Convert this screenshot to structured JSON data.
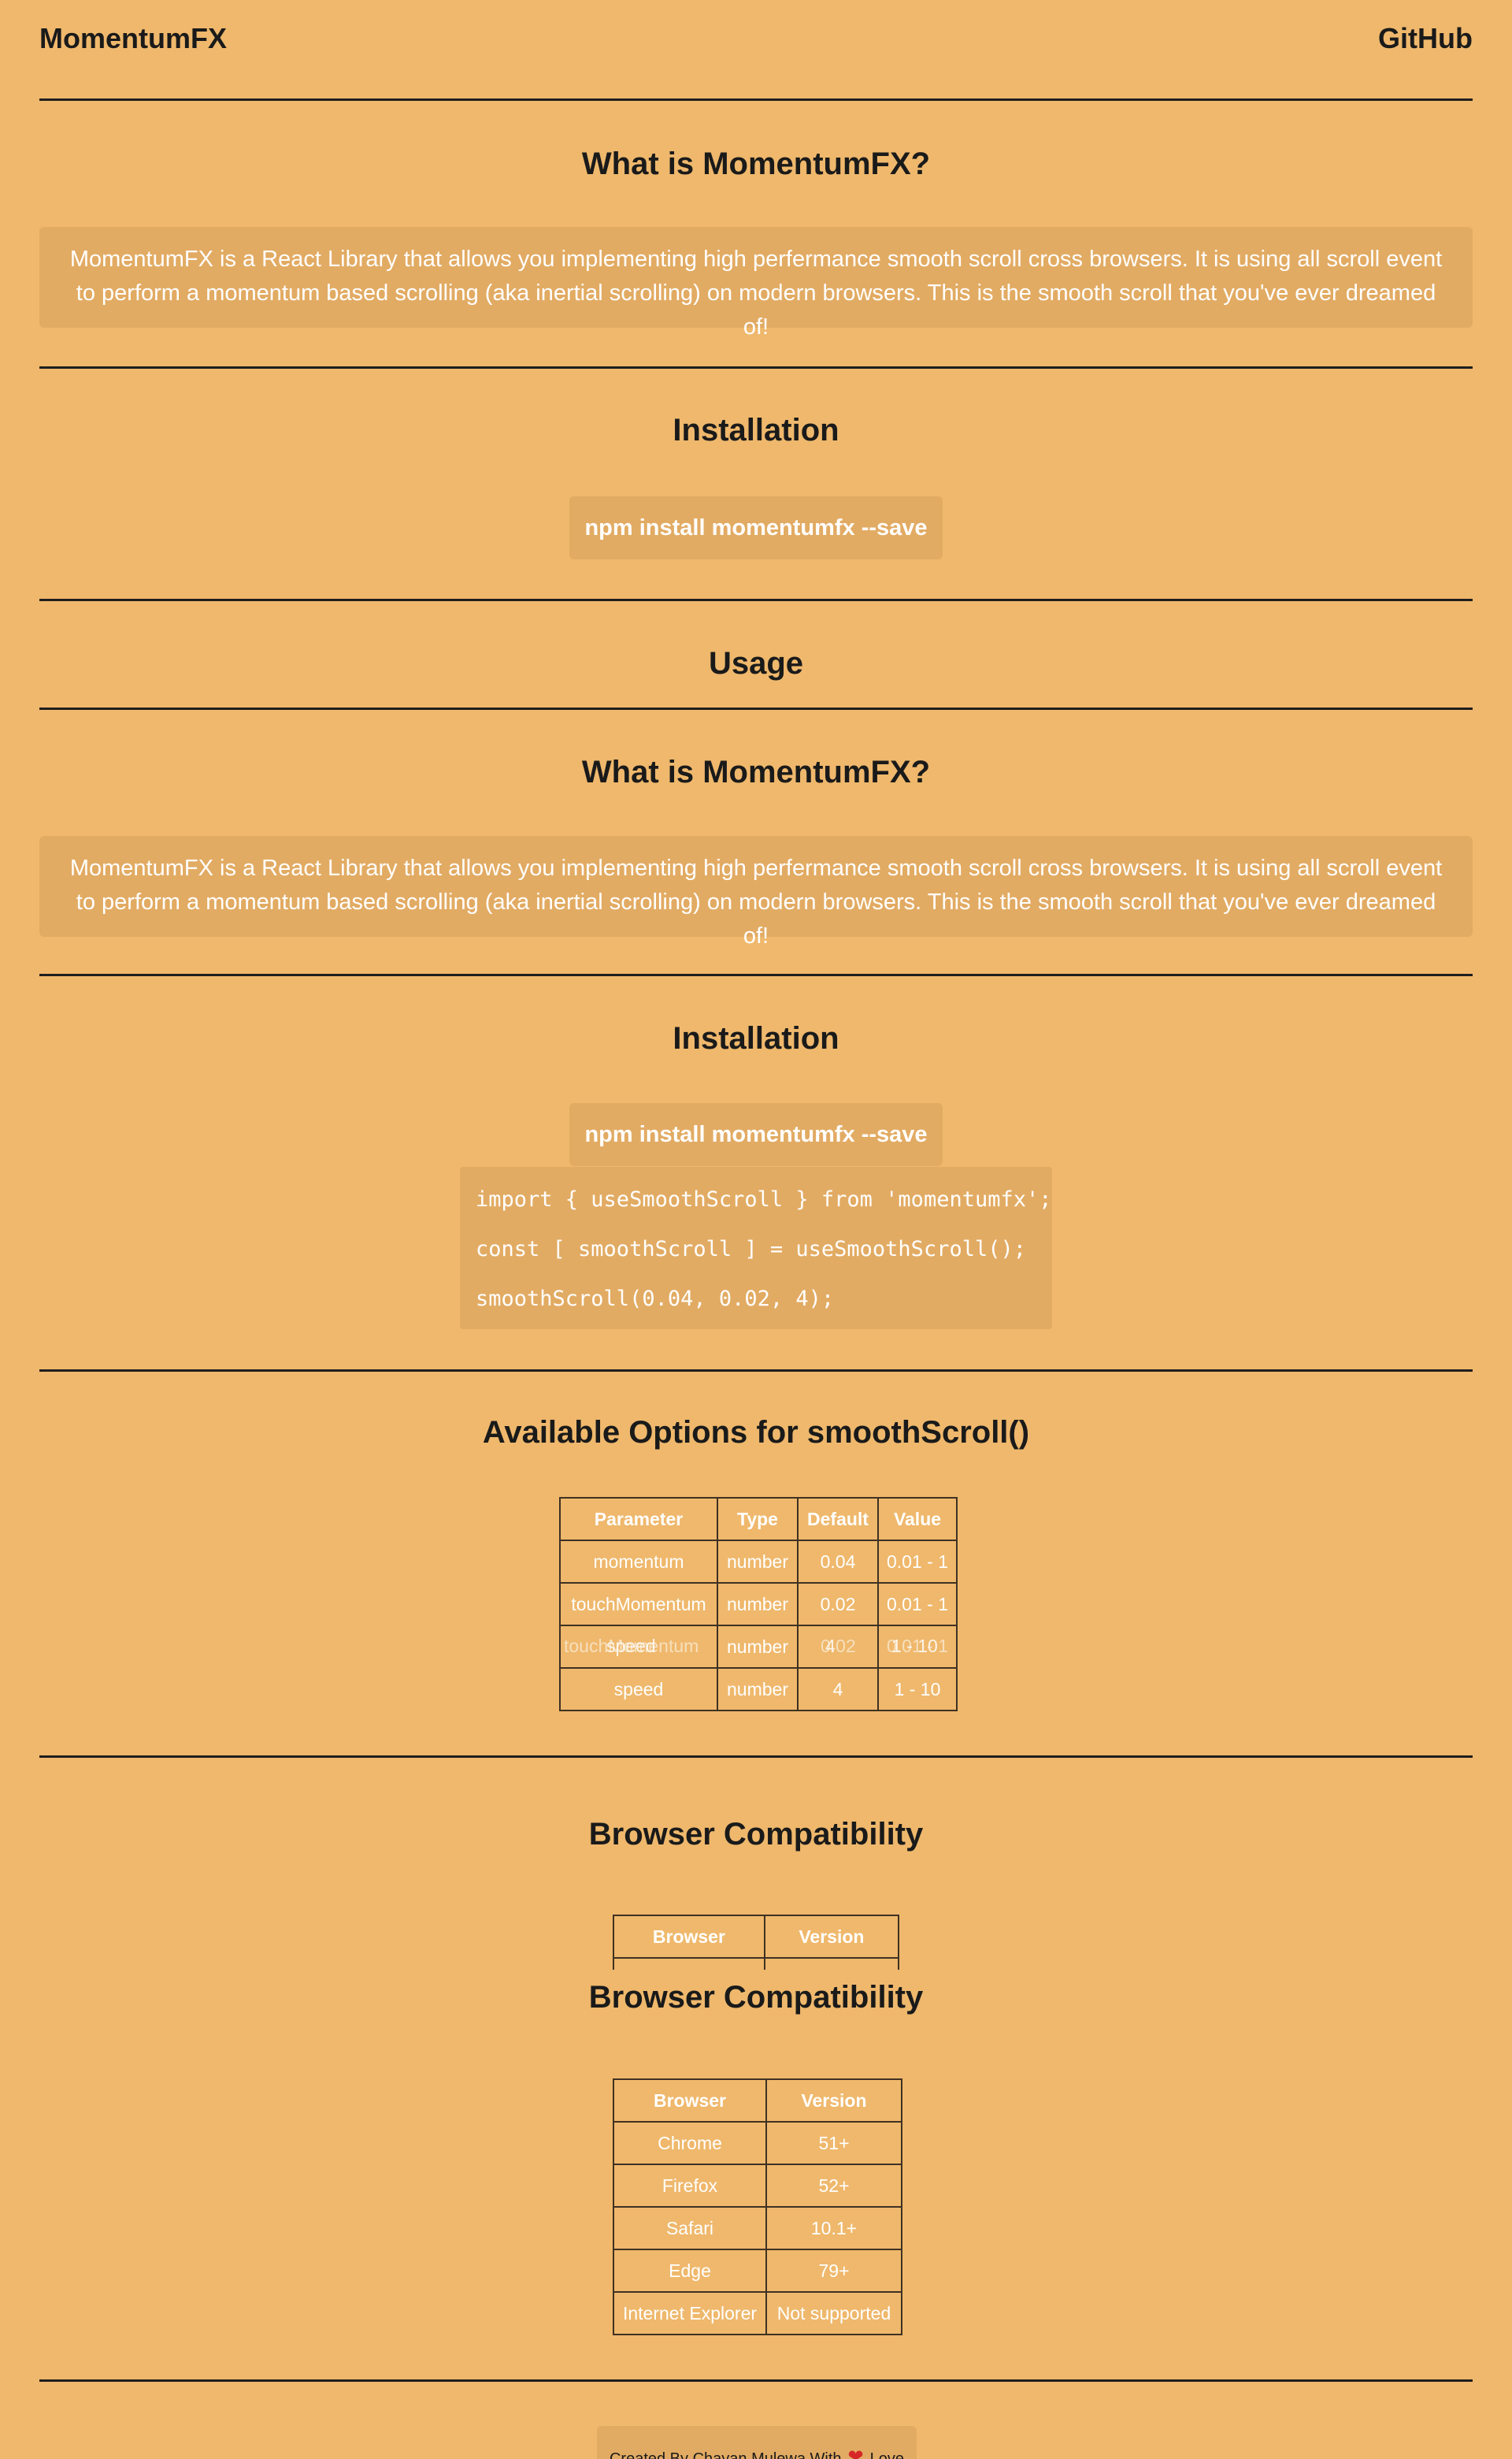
{
  "header": {
    "brand": "MomentumFX",
    "github_label": "GitHub"
  },
  "intro": {
    "title": "What is MomentumFX?",
    "description": "MomentumFX is a React Library that allows you implementing high perfermance smooth scroll cross browsers. It is using all scroll event to perform a momentum based scrolling (aka inertial scrolling) on modern browsers. This is the smooth scroll that you've ever dreamed of!"
  },
  "installation": {
    "title": "Installation",
    "command": "npm install momentumfx --save"
  },
  "usage": {
    "title": "Usage",
    "code_lines": [
      "import { useSmoothScroll } from 'momentumfx';",
      "const [ smoothScroll ] = useSmoothScroll();",
      "smoothScroll(0.04, 0.02, 4);"
    ]
  },
  "options": {
    "title": "Available Options for smoothScroll()",
    "headers": [
      "Parameter",
      "Type",
      "Default",
      "Value"
    ],
    "rows": [
      [
        "momentum",
        "number",
        "0.04",
        "0.01 - 1"
      ],
      [
        "touchMomentum",
        "number",
        "0.02",
        "0.01 - 1"
      ],
      [
        "speed",
        "number",
        "4",
        "1 - 10"
      ]
    ]
  },
  "compat": {
    "title": "Browser Compatibility",
    "headers": [
      "Browser",
      "Version"
    ],
    "rows": [
      [
        "Chrome",
        "51+"
      ],
      [
        "Firefox",
        "52+"
      ],
      [
        "Safari",
        "10.1+"
      ],
      [
        "Edge",
        "79+"
      ],
      [
        "Internet Explorer",
        "Not supported"
      ]
    ]
  },
  "footer": {
    "prefix": "Created By Chayan Mulewa With",
    "suffix": "Love"
  },
  "colors": {
    "background": "#efb86c",
    "box": "#e2ab63",
    "rule": "#1e1e1e",
    "heart": "#d62828"
  }
}
